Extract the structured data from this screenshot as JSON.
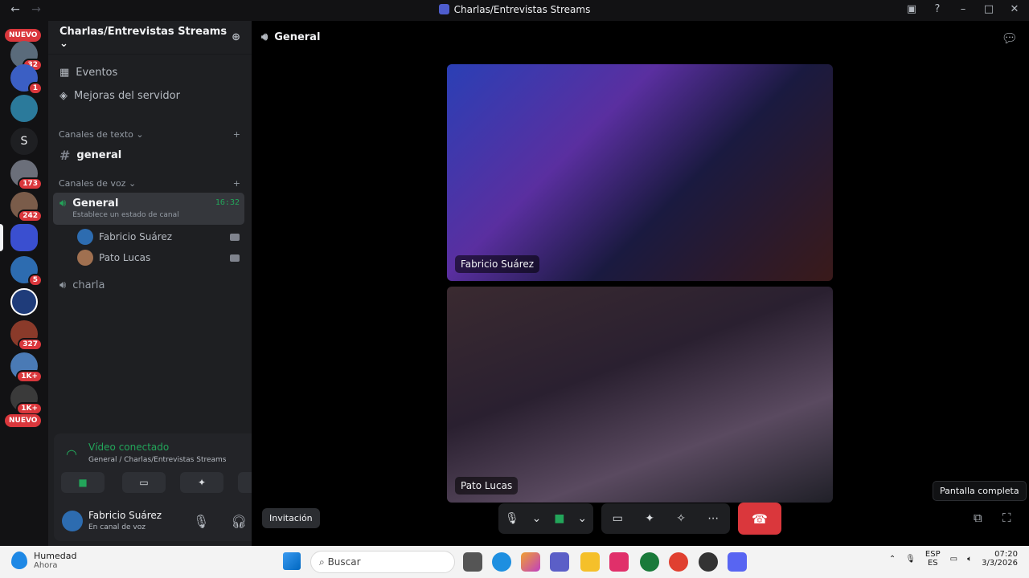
{
  "window": {
    "title": "Charlas/Entrevistas Streams"
  },
  "rail": {
    "nuevo_label": "NUEVO",
    "home_letter": "S",
    "badges": [
      "32",
      "1",
      "173",
      "242",
      "5",
      "327",
      "1K+",
      "1K+"
    ]
  },
  "sidebar": {
    "server_name": "Charlas/Entrevistas Streams",
    "events_label": "Eventos",
    "boost_label": "Mejoras del servidor",
    "text_category": "Canales de texto",
    "text_channel": "general",
    "voice_category": "Canales de voz",
    "voice_channel": "General",
    "voice_channel_status": "Establece un estado de canal",
    "voice_channel_time": "16:32",
    "voice_users": [
      "Fabricio Suárez",
      "Pato Lucas"
    ],
    "voice_channel_2": "charla"
  },
  "voice_panel": {
    "status": "Vídeo conectado",
    "location": "General / Charlas/Entrevistas Streams"
  },
  "user": {
    "name": "Fabricio Suárez",
    "status": "En canal de voz"
  },
  "main": {
    "channel": "General",
    "tiles": [
      "Fabricio Suárez",
      "Pato Lucas"
    ],
    "invite_label": "Invitación",
    "tooltip": "Pantalla completa"
  },
  "taskbar": {
    "weather_title": "Humedad",
    "weather_sub": "Ahora",
    "search_placeholder": "Buscar",
    "lang1": "ESP",
    "lang2": "ES",
    "time": "07:20",
    "date": "3/3/2026"
  }
}
